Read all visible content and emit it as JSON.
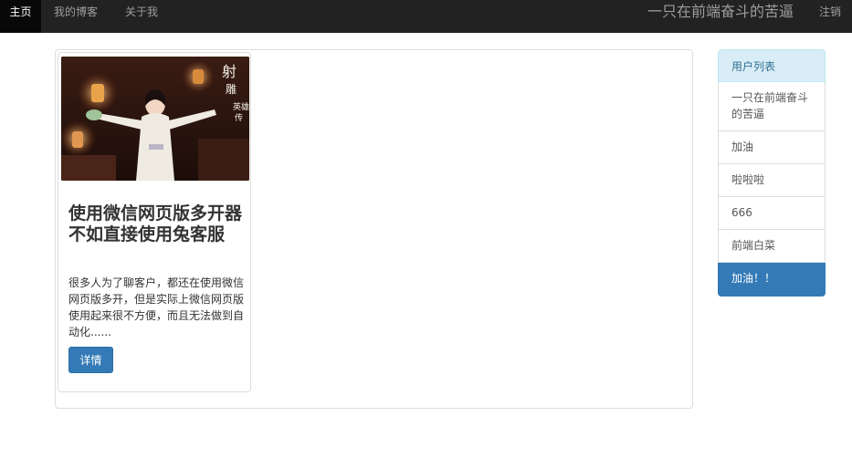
{
  "nav": {
    "items": [
      {
        "label": "主页"
      },
      {
        "label": "我的博客"
      },
      {
        "label": "关于我"
      }
    ],
    "brand": "一只在前端奋斗的苦逼",
    "logout": "注销"
  },
  "post": {
    "title": "使用微信网页版多开器 不如直接使用兔客服",
    "excerpt": "很多人为了聊客户，都还在使用微信网页版多开，但是实际上微信网页版使用起来很不方便，而且无法做到自动化......",
    "button_label": "详情",
    "image_caption": "射雕英雄传"
  },
  "user_list": {
    "heading": "用户列表",
    "items": [
      {
        "label": "一只在前端奋斗的苦逼"
      },
      {
        "label": "加油"
      },
      {
        "label": "啦啦啦"
      },
      {
        "label": "666"
      },
      {
        "label": "前端白菜"
      },
      {
        "label": "加油！！"
      }
    ]
  },
  "colors": {
    "navbar": "#222222",
    "primary": "#337ab7",
    "list_heading_bg": "#d9edf7",
    "list_heading_text": "#31708f"
  }
}
